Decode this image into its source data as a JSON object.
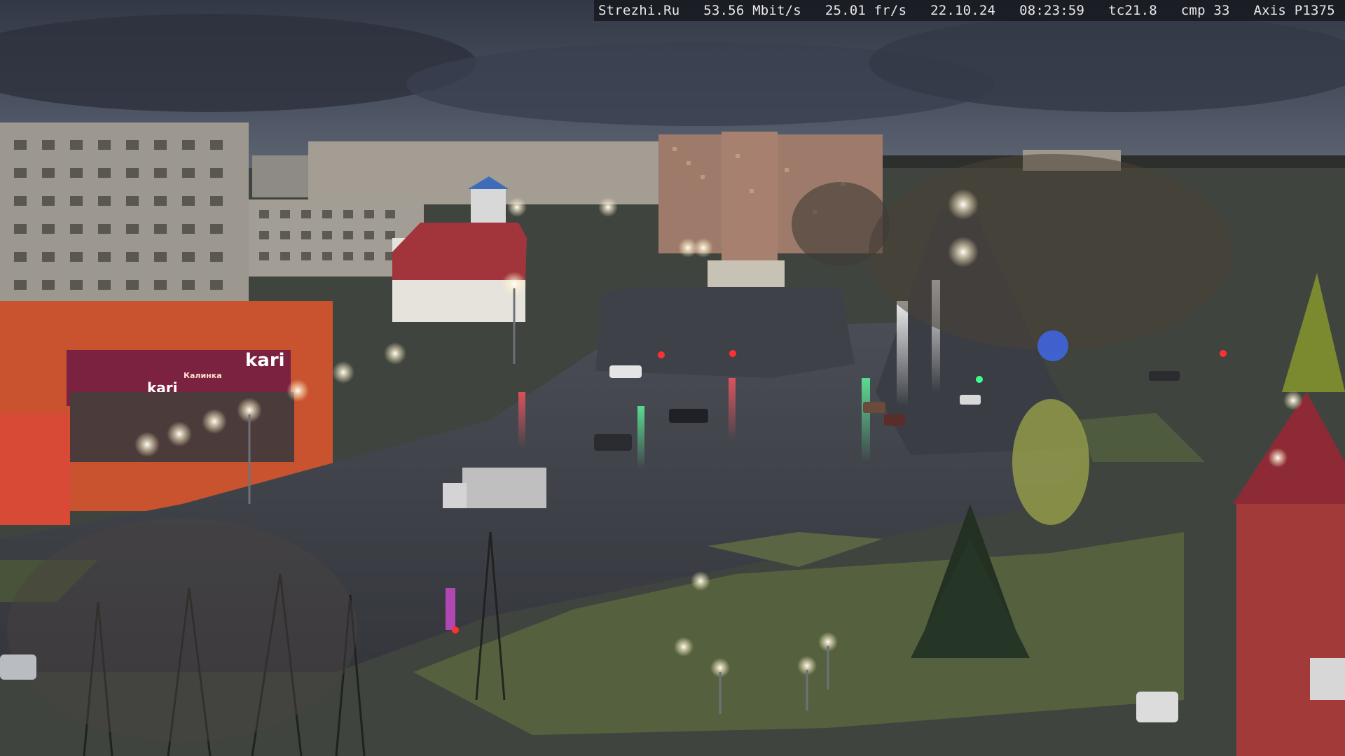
{
  "overlay": {
    "site": "Strezhi.Ru",
    "bitrate": "53.56 Mbit/s",
    "framerate": "25.01 fr/s",
    "date": "22.10.24",
    "time": "08:23:59",
    "tc": "tc21.8",
    "cmp": "cmp 33",
    "camera": "Axis P1375"
  },
  "signs": {
    "store_logo": "kari",
    "store_logo_small": "kari",
    "store_banner_left": "Калинка"
  },
  "scene": {
    "description_icon": "city-street-webcam",
    "colors": {
      "sky": "#3c4350",
      "road": "#3d4047",
      "grass": "#4d5a3b",
      "store_front": "#c9532e",
      "store_banner": "#7a2240",
      "building": "#9a958c",
      "red_building": "#a33a3a"
    }
  }
}
